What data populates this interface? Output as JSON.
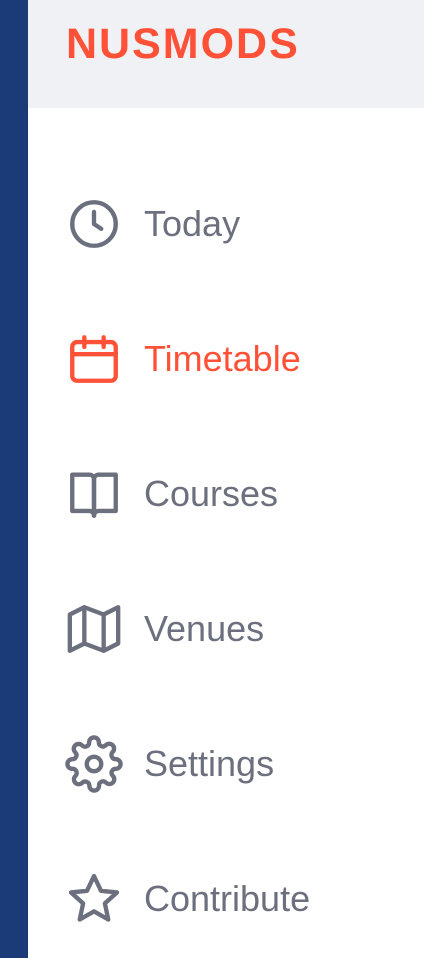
{
  "brand": {
    "name": "NUSMODS",
    "color": "#ff5138"
  },
  "colors": {
    "sidebar_border": "#1b3a78",
    "header_bg": "#eff1f4",
    "inactive_text": "#6c6f7d",
    "active_text": "#ff5138"
  },
  "nav": {
    "items": [
      {
        "label": "Today",
        "icon": "clock-icon",
        "active": false
      },
      {
        "label": "Timetable",
        "icon": "calendar-icon",
        "active": true
      },
      {
        "label": "Courses",
        "icon": "book-icon",
        "active": false
      },
      {
        "label": "Venues",
        "icon": "map-icon",
        "active": false
      },
      {
        "label": "Settings",
        "icon": "gear-icon",
        "active": false
      },
      {
        "label": "Contribute",
        "icon": "star-icon",
        "active": false
      }
    ]
  }
}
